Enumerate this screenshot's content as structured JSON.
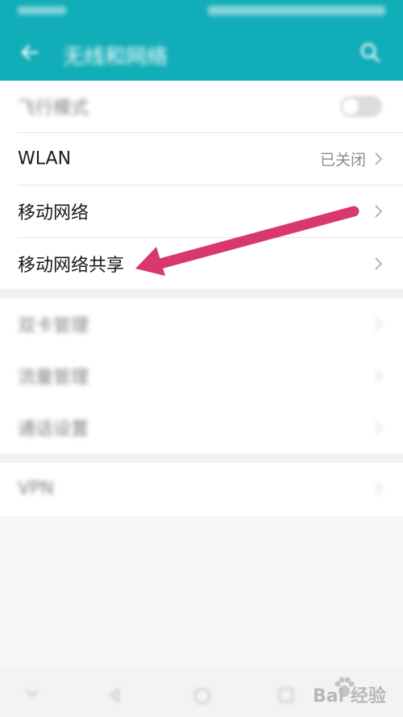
{
  "header": {
    "title": "无线和网络",
    "back_icon": "back-arrow-icon",
    "search_icon": "search-icon",
    "background_color": "#11adb8"
  },
  "settings_group_1": [
    {
      "label": "飞行模式",
      "type": "toggle"
    },
    {
      "label": "WLAN",
      "value": "已关闭",
      "type": "link"
    },
    {
      "label": "移动网络",
      "type": "link"
    },
    {
      "label": "移动网络共享",
      "type": "link"
    }
  ],
  "settings_group_2": [
    {
      "label": "双卡管理",
      "type": "link"
    },
    {
      "label": "流量管理",
      "type": "link"
    },
    {
      "label": "通话设置",
      "type": "link"
    }
  ],
  "settings_group_3": [
    {
      "label": "VPN",
      "type": "link"
    }
  ],
  "annotation": {
    "arrow_color": "#d8386f",
    "points_to": "移动网络共享"
  },
  "watermark": {
    "text": "Bai 经验"
  }
}
